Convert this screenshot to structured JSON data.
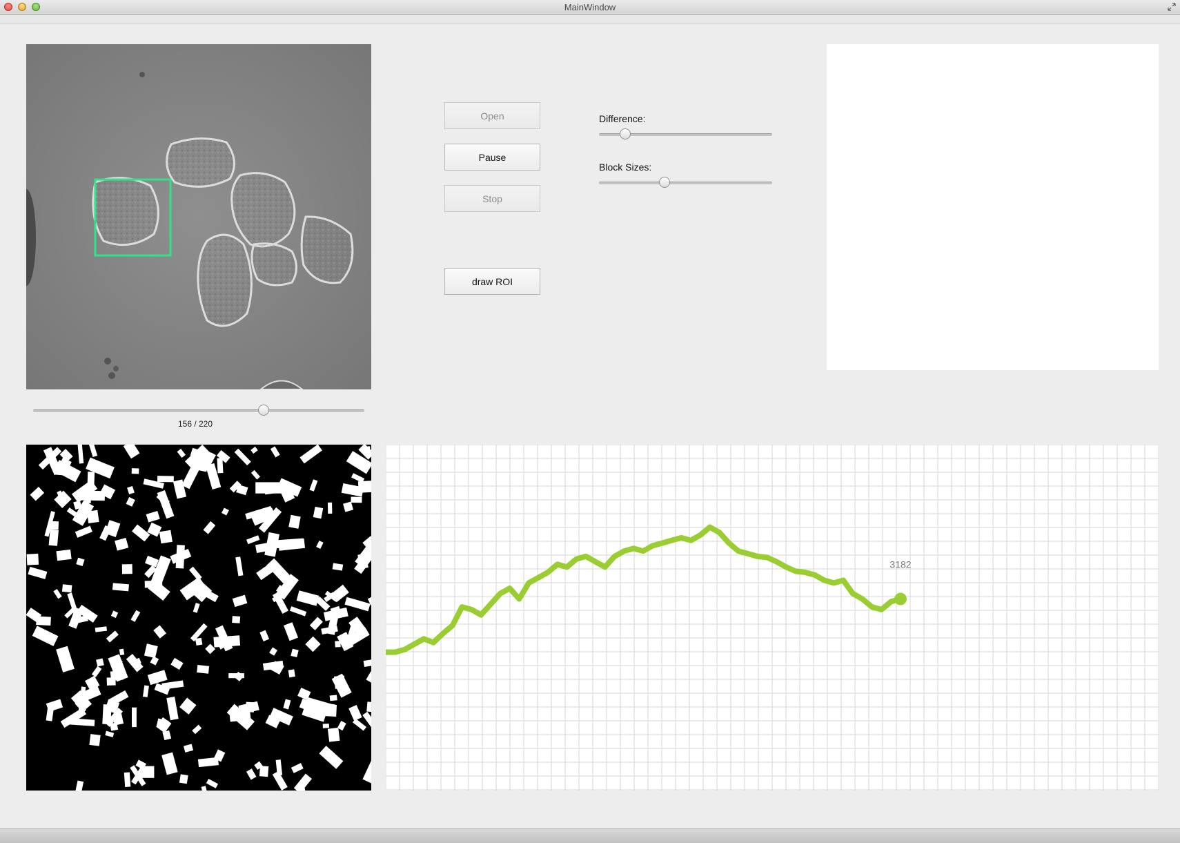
{
  "window": {
    "title": "MainWindow"
  },
  "controls": {
    "open_label": "Open",
    "pause_label": "Pause",
    "stop_label": "Stop",
    "draw_roi_label": "draw ROI"
  },
  "frame": {
    "label": "156 / 220",
    "current": 156,
    "total": 220
  },
  "params": {
    "difference_label": "Difference:",
    "difference_value": 0.15,
    "block_sizes_label": "Block Sizes:",
    "block_sizes_value": 0.38
  },
  "colors": {
    "roi_box": "#36e08a",
    "plot_line": "#9acd32",
    "grid": "#d7d7d7"
  },
  "chart_data": {
    "type": "line",
    "title": "",
    "xlabel": "",
    "ylabel": "",
    "grid": true,
    "last_value_label": "3182",
    "series": [
      {
        "values": [
          2960,
          2960,
          2965,
          2975,
          2985,
          2978,
          2995,
          3010,
          3045,
          3040,
          3030,
          3050,
          3070,
          3080,
          3060,
          3090,
          3100,
          3110,
          3125,
          3120,
          3135,
          3140,
          3130,
          3120,
          3140,
          3150,
          3155,
          3150,
          3160,
          3165,
          3170,
          3175,
          3170,
          3180,
          3195,
          3185,
          3165,
          3150,
          3145,
          3140,
          3138,
          3130,
          3120,
          3112,
          3110,
          3105,
          3095,
          3090,
          3095,
          3070,
          3060,
          3045,
          3040,
          3055,
          3060
        ]
      }
    ],
    "ylim": [
      2700,
      3350
    ]
  }
}
